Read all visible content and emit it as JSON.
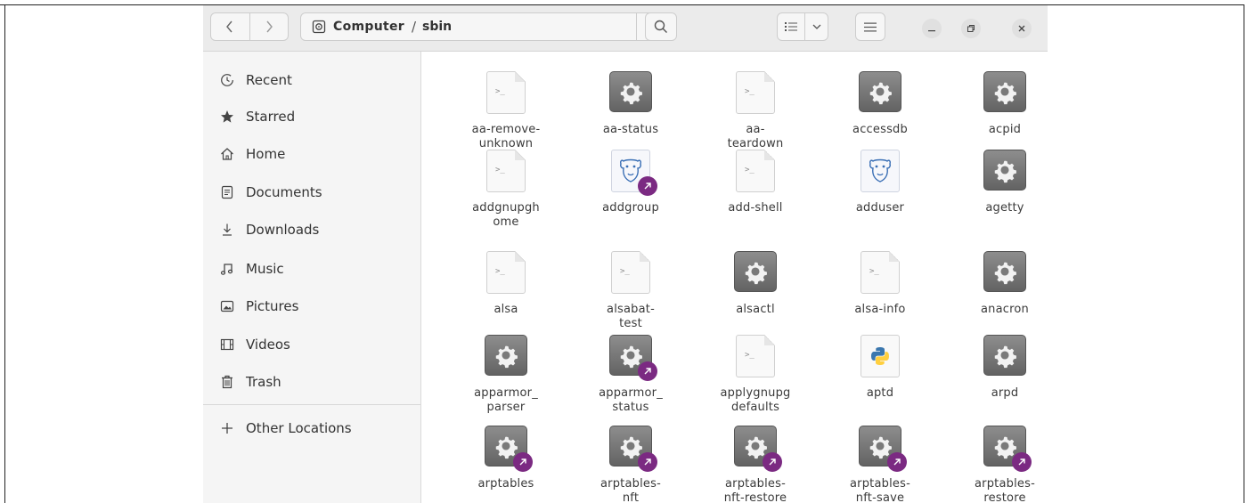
{
  "header": {
    "back_icon": "chevron-left-icon",
    "forward_icon": "chevron-right-icon",
    "breadcrumb": {
      "root": "Computer",
      "separator": "/",
      "current": "sbin"
    },
    "path_menu_icon": "vertical-dots-icon",
    "search_icon": "search-icon",
    "view_list_icon": "list-view-icon",
    "view_toggle_icon": "chevron-down-icon",
    "menu_icon": "hamburger-icon",
    "window_controls": [
      "minimize",
      "restore",
      "close"
    ]
  },
  "sidebar": {
    "items": [
      {
        "label": "Recent",
        "icon": "clock-icon"
      },
      {
        "label": "Starred",
        "icon": "star-icon"
      },
      {
        "label": "Home",
        "icon": "home-icon"
      },
      {
        "label": "Documents",
        "icon": "document-icon"
      },
      {
        "label": "Downloads",
        "icon": "download-icon"
      },
      {
        "label": "Music",
        "icon": "music-icon"
      },
      {
        "label": "Pictures",
        "icon": "picture-icon"
      },
      {
        "label": "Videos",
        "icon": "video-icon"
      },
      {
        "label": "Trash",
        "icon": "trash-icon"
      }
    ],
    "other_locations": {
      "label": "Other Locations",
      "icon": "plus-icon"
    }
  },
  "files": [
    {
      "name": "aa-remove-unknown",
      "type": "script"
    },
    {
      "name": "aa-status",
      "type": "executable"
    },
    {
      "name": "aa-teardown",
      "type": "script"
    },
    {
      "name": "accessdb",
      "type": "executable"
    },
    {
      "name": "acpid",
      "type": "executable"
    },
    {
      "name": "addgnupghome",
      "type": "script"
    },
    {
      "name": "addgroup",
      "type": "perl-link"
    },
    {
      "name": "add-shell",
      "type": "script"
    },
    {
      "name": "adduser",
      "type": "perl"
    },
    {
      "name": "agetty",
      "type": "executable"
    },
    {
      "name": "alsa",
      "type": "script"
    },
    {
      "name": "alsabat-test",
      "type": "script"
    },
    {
      "name": "alsactl",
      "type": "executable"
    },
    {
      "name": "alsa-info",
      "type": "script"
    },
    {
      "name": "anacron",
      "type": "executable"
    },
    {
      "name": "apparmor_parser",
      "type": "executable"
    },
    {
      "name": "apparmor_status",
      "type": "executable-link"
    },
    {
      "name": "applygnupgdefaults",
      "type": "script"
    },
    {
      "name": "aptd",
      "type": "python"
    },
    {
      "name": "arpd",
      "type": "executable"
    },
    {
      "name": "arptables",
      "type": "executable-link"
    },
    {
      "name": "arptables-nft",
      "type": "executable-link"
    },
    {
      "name": "arptables-nft-restore",
      "type": "executable-link"
    },
    {
      "name": "arptables-nft-save",
      "type": "executable-link"
    },
    {
      "name": "arptables-restore",
      "type": "executable-link"
    }
  ],
  "file_labels": [
    [
      "aa-remove-",
      "unknown"
    ],
    [
      "aa-status"
    ],
    [
      "aa-",
      "teardown"
    ],
    [
      "accessdb"
    ],
    [
      "acpid"
    ],
    [
      "addgnupgh",
      "ome"
    ],
    [
      "addgroup"
    ],
    [
      "add-shell"
    ],
    [
      "adduser"
    ],
    [
      "agetty"
    ],
    [
      "alsa"
    ],
    [
      "alsabat-",
      "test"
    ],
    [
      "alsactl"
    ],
    [
      "alsa-info"
    ],
    [
      "anacron"
    ],
    [
      "apparmor_",
      "parser"
    ],
    [
      "apparmor_",
      "status"
    ],
    [
      "applygnupg",
      "defaults"
    ],
    [
      "aptd"
    ],
    [
      "arpd"
    ],
    [
      "arptables"
    ],
    [
      "arptables-",
      "nft"
    ],
    [
      "arptables-",
      "nft-restore"
    ],
    [
      "arptables-",
      "nft-save"
    ],
    [
      "arptables-",
      "restore"
    ]
  ],
  "colors": {
    "link_badge": "#7b2a82",
    "executable_bg": "#7a7a7a",
    "sidebar_bg": "#f5f5f5",
    "header_bg": "#ebebeb"
  }
}
